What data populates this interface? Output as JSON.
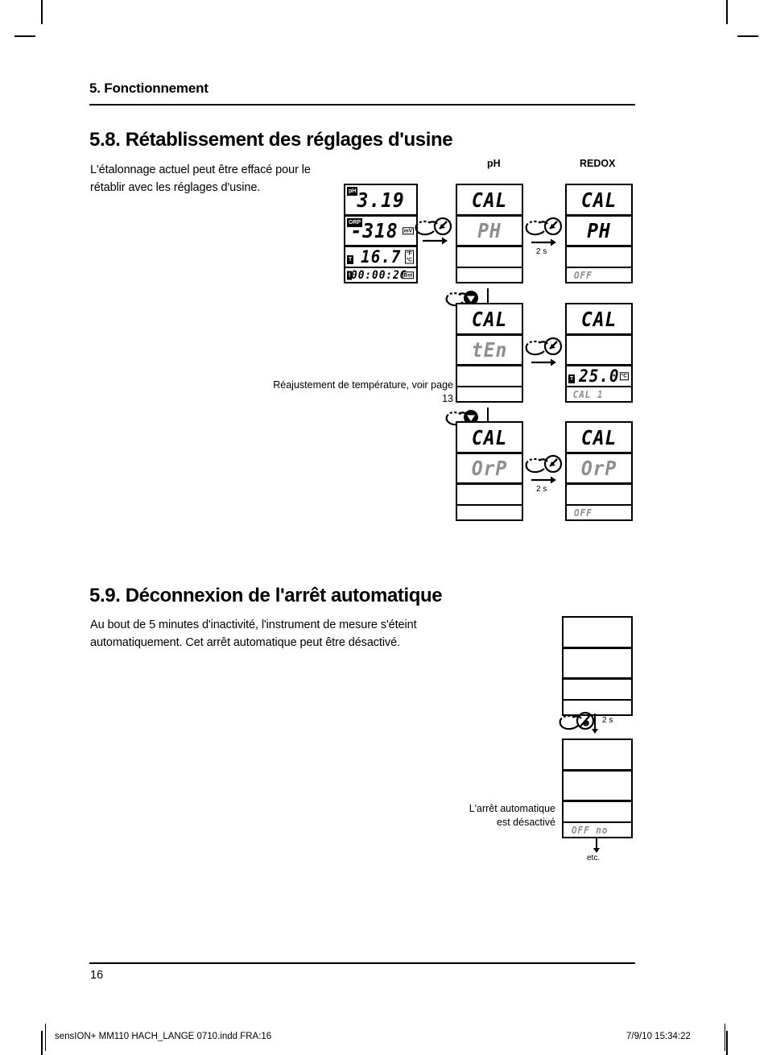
{
  "header": {
    "chapter": "5. Fonctionnement"
  },
  "sections": [
    {
      "number_title": "5.8. Rétablissement des réglages d'usine",
      "body": "L'étalonnage actuel peut être effacé pour le rétablir avec les réglages d'usine."
    },
    {
      "number_title": "5.9. Déconnexion de l'arrêt automatique",
      "body": "Au bout de 5 minutes d'inactivité, l'instrument de mesure s'éteint automatiquement. Cet arrêt automatique peut être désactivé."
    }
  ],
  "diagram58": {
    "col_headers": {
      "ph": "pH",
      "redox": "REDOX"
    },
    "measure_display": {
      "rows": [
        {
          "tag": "pH",
          "value": "3.19",
          "unit": ""
        },
        {
          "tag": "ORP",
          "value": "-318",
          "unit": "mV"
        },
        {
          "tag": "T",
          "value": "16.7",
          "unit_top": "°F",
          "unit_bottom": "°C"
        },
        {
          "tag": "t",
          "value": "00:00:26",
          "unit": "Bst"
        }
      ]
    },
    "steps": [
      {
        "left": {
          "line1": "CAL",
          "line2": "PH",
          "line3": "",
          "line4": ""
        },
        "right": {
          "line1": "CAL",
          "line2": "PH",
          "line3": "",
          "line4": "OFF"
        },
        "hold": "2 s"
      },
      {
        "left": {
          "line1": "CAL",
          "line2": "tEn",
          "line3": "",
          "line4": ""
        },
        "right": {
          "line1": "CAL",
          "line2": "",
          "line3": "25.0",
          "line3_tag": "T",
          "line3_unit": "°C",
          "line4": "CAL 1"
        },
        "hold": ""
      },
      {
        "left": {
          "line1": "CAL",
          "line2": "OrP",
          "line3": "",
          "line4": ""
        },
        "right": {
          "line1": "CAL",
          "line2": "OrP",
          "line3": "",
          "line4": "OFF"
        },
        "hold": "2 s"
      }
    ],
    "caption_temp": "Réajustement de température, voir page 13"
  },
  "diagram59": {
    "hold": "2 s",
    "display_before": {
      "line1": "",
      "line2": "",
      "line3": "",
      "line4": ""
    },
    "display_after": {
      "line1": "",
      "line2": "",
      "line3": "",
      "line4": "OFF  no"
    },
    "caption": "L'arrêt automatique\nest désactivé",
    "etc_label": "etc."
  },
  "footer": {
    "page_number": "16",
    "file_info": "sensION+ MM110 HACH_LANGE 0710.indd   FRA:16",
    "timestamp": "7/9/10   15:34:22"
  },
  "icons": {
    "press_enter": "hand-press-enter-icon",
    "press_down": "hand-press-down-icon",
    "press_power": "hand-press-power-icon"
  }
}
